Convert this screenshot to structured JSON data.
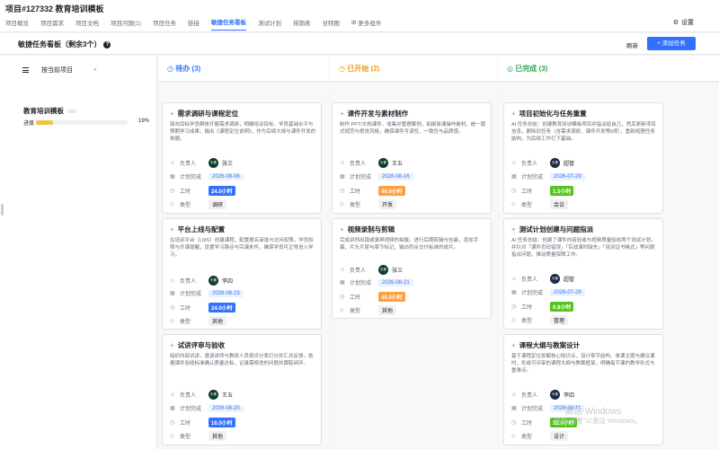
{
  "project_title": "项目#127332 教育培训模板",
  "tabs": [
    "项目概览",
    "项目需求",
    "项目文档",
    "项目问题(1)",
    "项目任务",
    "链接",
    "敏捷任务看板",
    "测试计划",
    "排期表",
    "甘特图",
    "更多组件"
  ],
  "settings_label": "设置",
  "board_title": "敏捷任务看板（剩余3个）",
  "refresh_label": "刷新",
  "add_task_label": "+ 添加任务",
  "grouping_label": "按当前项目",
  "project_row": {
    "name": "教育培训模板",
    "progress_label": "进度",
    "progress_value": "19%",
    "progress_fraction": 0.19
  },
  "columns": [
    {
      "title": "待办 (3)",
      "icon": "clock-icon",
      "color": "#3370ff"
    },
    {
      "title": "已开始 (2)",
      "icon": "clock-icon",
      "color": "#f39c12"
    },
    {
      "title": "已完成 (3)",
      "icon": "check-circle-icon",
      "color": "#34a853"
    }
  ],
  "field_labels": {
    "owner": "负责人",
    "planned": "计划完成",
    "hours": "工时",
    "type": "类型"
  },
  "colors": {
    "accent": "#3370ff",
    "hours_todo": "#3370ff",
    "hours_started": "#ff9f43",
    "hours_done": "#52c41a",
    "progress": "#f5c342"
  },
  "cards": [
    {
      "title": "需求调研与课程定位",
      "desc": "面向目标学员群体开展需求调研，明确培训目标、学员基础水平与预期学习成果，输出《课程定位说明》，作为后续大纲与课件开发的依据。",
      "owner": "张三",
      "avatar": "头像",
      "date": "2026-08-06",
      "hours": "24.0小时",
      "type": "调研"
    },
    {
      "title": "平台上线与配置",
      "desc": "在培训平台（LMS）创建课程，配置报名审批与访问权限，学员权限与开课提醒，设置学习路径与完课条件，确保学员可正常进入学习。",
      "owner": "李四",
      "avatar": "头像",
      "date": "2026-08-23",
      "hours": "24.0小时",
      "type": "其他"
    },
    {
      "title": "试讲评审与验收",
      "desc": "组织内部试讲，邀请讲师与教研人员按评分表打分并汇总反馈，依据课件验收标准确认质量达标，记录需修改的问题并跟踪闭环。",
      "owner": "王五",
      "avatar": "头像",
      "date": "2026-08-25",
      "hours": "16.0小时",
      "type": "其他"
    },
    {
      "title": "课件开发与素材制作",
      "desc": "制作 PPT/文档课件、收集并整理案例，拍摄录课操作素材，统一版式规范与视觉风格，确保课件可读性、一致性与品牌感。",
      "owner": "王五",
      "avatar": "头像",
      "date": "2026-08-16",
      "hours": "40.0小时",
      "type": "开发"
    },
    {
      "title": "视频录制与剪辑",
      "desc": "完成讲师出镜或录屏视频的拍摄，进行后期剪辑与包装，添加字幕、片头片尾与章节标记，输出符合交付标准的成片。",
      "owner": "张三",
      "avatar": "头像",
      "date": "2026-08-21",
      "hours": "40.0小时",
      "type": "其他"
    },
    {
      "title": "项目初始化与任务重置",
      "desc": "AI 任务总结：创建教育培训模板项目并指派给自己，然后更新项目信息，删除旧任务（含需求调研、课件开发等8项），重新梳理任务结构，为后续工作打下基础。",
      "owner": "超管",
      "avatar": "头像",
      "date": "2026-07-29",
      "hours": "1.5小时",
      "type": "会议"
    },
    {
      "title": "测试计划创建与问题指派",
      "desc": "AI 任务总结：创建了课件内容验收与视频质量验收两个测试计划，并针对「课件页码错误」「实战课时缺失」「培训证书格式」等问题指派问题，推动质量保障工作。",
      "owner": "超管",
      "avatar": "头像",
      "date": "2026-07-29",
      "hours": "0.8小时",
      "type": "管理"
    },
    {
      "title": "课程大纲与教案设计",
      "desc": "基于课程定位拆解核心知识点，设计章节结构、单课主题与建议课时，形成可评审的课程大纲与教案框架，明确每节课的教学形式与重难点。",
      "owner": "李四",
      "avatar": "头像",
      "date": "2026-08-11",
      "hours": "32.0小时",
      "type": "设计"
    }
  ],
  "windows_watermark": {
    "line1": "激活 Windows",
    "line2": "转到\"设置\"以激活 Windows。"
  }
}
